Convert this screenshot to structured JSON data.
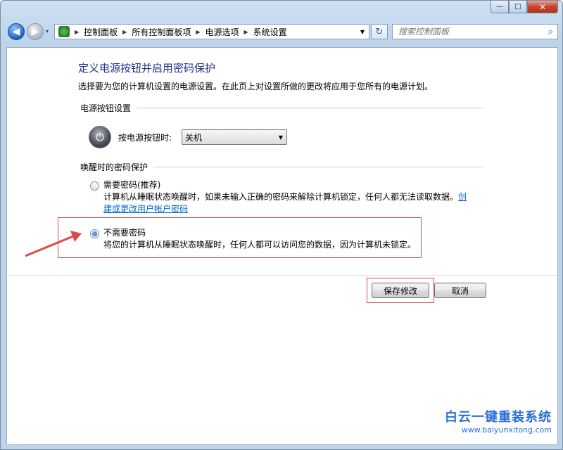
{
  "window": {
    "min_label": "—",
    "max_label": "□",
    "close_label": "✕"
  },
  "nav": {
    "back_icon": "◀",
    "forward_icon": "▶",
    "recent_icon": "▾",
    "breadcrumbs": [
      "控制面板",
      "所有控制面板项",
      "电源选项",
      "系统设置"
    ],
    "breadcrumb_separator": "▶",
    "address_dropdown": "▼",
    "refresh_icon": "↻",
    "search_placeholder": "搜索控制面板",
    "search_icon": "⌕"
  },
  "page": {
    "title": "定义电源按钮并启用密码保护",
    "description": "选择要为您的计算机设置的电源设置。在此页上对设置所做的更改将应用于您所有的电源计划。"
  },
  "power_buttons": {
    "section_title": "电源按钮设置",
    "power_icon": "⏻",
    "label": "按电源按钮时:",
    "selected_value": "关机",
    "dropdown_arrow": "▼"
  },
  "wake_password": {
    "section_title": "唤醒时的密码保护",
    "options": [
      {
        "label": "需要密码(推荐)",
        "description": "计算机从睡眠状态唤醒时，如果未输入正确的密码来解除计算机锁定，任何人都无法读取数据。",
        "link": "创建或更改用户帐户密码",
        "checked": false
      },
      {
        "label": "不需要密码",
        "description": "将您的计算机从睡眠状态唤醒时，任何人都可以访问您的数据，因为计算机未锁定。",
        "checked": true
      }
    ]
  },
  "actions": {
    "save_label": "保存修改",
    "cancel_label": "取消"
  },
  "watermark": {
    "title": "白云一键重装系统",
    "url": "www.baiyunxitong.com"
  },
  "colors": {
    "title_blue": "#1e3287",
    "link_blue": "#0066cc",
    "annotation_red": "#d84b4b",
    "watermark_blue": "#2a6fd6"
  }
}
